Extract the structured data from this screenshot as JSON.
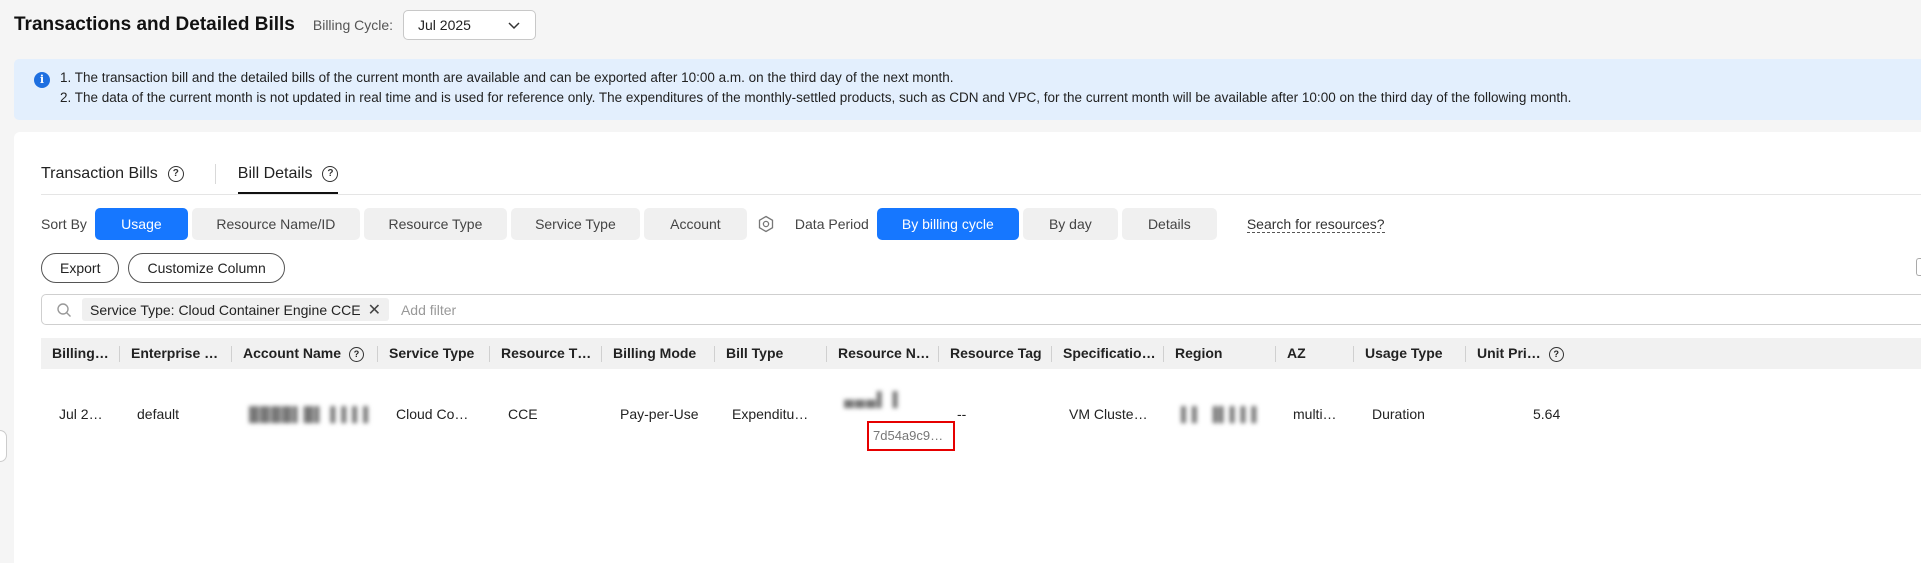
{
  "header": {
    "title": "Transactions and Detailed Bills",
    "billing_cycle_label": "Billing Cycle:",
    "billing_cycle_value": "Jul 2025"
  },
  "notice": {
    "line1": "1. The transaction bill and the detailed bills of the current month are available and can be exported after 10:00 a.m. on the third day of the next month.",
    "line2": "2. The data of the current month is not updated in real time and is used for reference only. The expenditures of the monthly-settled products, such as CDN and VPC, for the current month will be available after 10:00 on the third day of the following month."
  },
  "tabs": [
    {
      "label": "Transaction Bills"
    },
    {
      "label": "Bill Details"
    }
  ],
  "sort": {
    "label": "Sort By",
    "options": [
      "Usage",
      "Resource Name/ID",
      "Resource Type",
      "Service Type",
      "Account"
    ]
  },
  "data_period": {
    "label": "Data Period",
    "options": [
      "By billing cycle",
      "By day",
      "Details"
    ]
  },
  "search_link": "Search for resources?",
  "buttons": {
    "export": "Export",
    "customize": "Customize Column"
  },
  "filter": {
    "chip": "Service Type: Cloud Container Engine CCE",
    "placeholder": "Add filter"
  },
  "table": {
    "headers": [
      "Billing…",
      "Enterprise …",
      "Account Name",
      "Service Type",
      "Resource T…",
      "Billing Mode",
      "Bill Type",
      "Resource N…",
      "Resource Tag",
      "Specificatio…",
      "Region",
      "AZ",
      "Usage Type",
      "Unit Pri…"
    ],
    "row": {
      "billing": "Jul 2…",
      "enterprise": "default",
      "account": "████▌█▌▐▐ ▌▌",
      "service": "Cloud Co…",
      "resource_type": "CCE",
      "billing_mode": "Pay-per-Use",
      "bill_type": "Expenditu…",
      "resource_name": "▄▄▄▌▐",
      "resource_id": "7d54a9c9…",
      "resource_tag": "--",
      "spec": "VM Cluste…",
      "region": "▌▌ ▐▌▌▌▌",
      "az": "multi…",
      "usage_type": "Duration",
      "unit_price": "5.64"
    }
  },
  "colors": {
    "primary": "#1677ff",
    "notice_bg": "#e3effd",
    "highlight": "#e60000"
  }
}
